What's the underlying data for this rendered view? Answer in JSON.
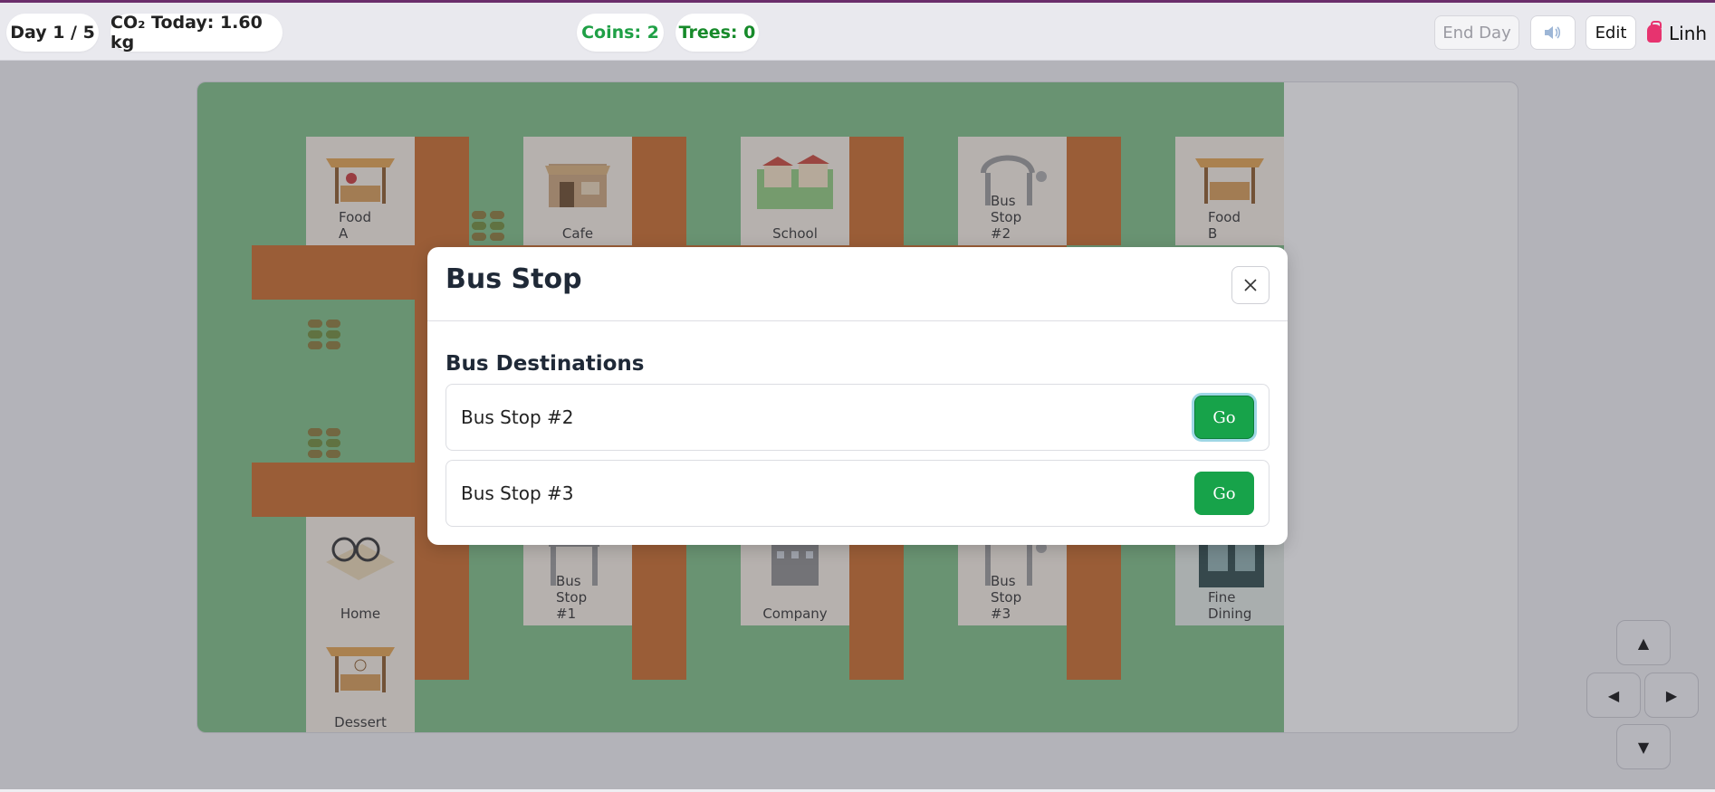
{
  "hud": {
    "day": "Day 1 / 5",
    "co2": "CO₂ Today: 1.60 kg",
    "coins": "Coins: 2",
    "trees": "Trees: 0",
    "end_day": "End Day",
    "sound_icon": "speaker-icon",
    "edit": "Edit",
    "user": "Linh",
    "user_icon": "backpack-icon"
  },
  "map": {
    "top_row": [
      "Food\nA",
      "Cafe",
      "School",
      "Bus\nStop\n#2",
      "Food\nB"
    ],
    "bottom_row": [
      "Home",
      "Bus\nStop\n#1",
      "Company",
      "Bus\nStop\n#3",
      "Fine\nDining"
    ],
    "extra": [
      "Dessert"
    ]
  },
  "modal": {
    "title": "Bus Stop",
    "close_icon": "close-icon",
    "section_title": "Bus Destinations",
    "destinations": [
      {
        "name": "Bus Stop #2",
        "action": "Go"
      },
      {
        "name": "Bus Stop #3",
        "action": "Go"
      }
    ]
  },
  "dpad": {
    "up": "▲",
    "left": "◀",
    "right": "▶",
    "down": "▼"
  },
  "colors": {
    "grass": "#7dbd85",
    "road": "#c86a2a",
    "go": "#17a34a",
    "accent": "#6b2e6b"
  }
}
